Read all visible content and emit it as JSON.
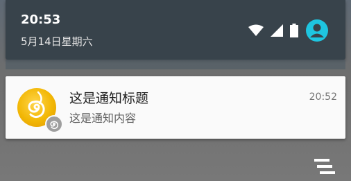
{
  "quick_settings": {
    "time": "20:53",
    "date": "5月14日星期六",
    "icons": [
      "wifi-icon",
      "signal-icon",
      "battery-icon",
      "account-icon"
    ]
  },
  "notification": {
    "title": "这是通知标题",
    "text": "这是通知内容",
    "time": "20:52",
    "app_icon": "app-spiral-icon",
    "badge_icon": "small-app-badge-icon"
  },
  "actions": {
    "clear_all_icon": "clear-all-icon"
  },
  "colors": {
    "panel": "#38434b",
    "card": "#fafafa",
    "accent": "#1ec5e0",
    "icon_orange": "#f2b705"
  }
}
